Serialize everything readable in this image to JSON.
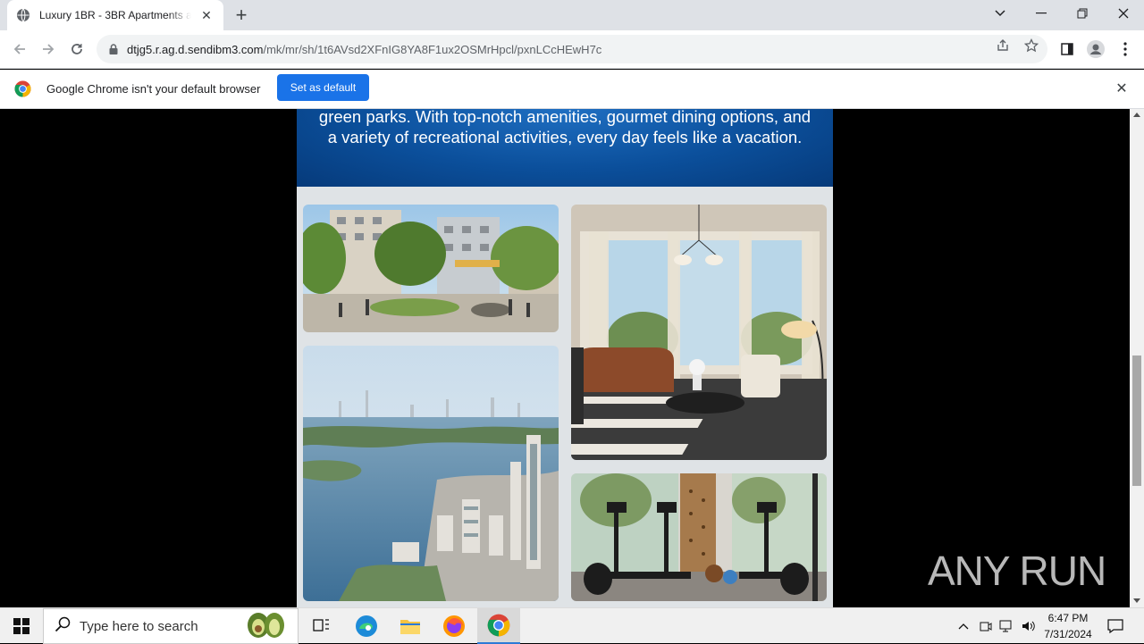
{
  "browser": {
    "tab": {
      "title": "Luxury 1BR - 3BR Apartments at"
    },
    "address": {
      "host": "dtjg5.r.ag.d.sendibm3.com",
      "path": "/mk/mr/sh/1t6AVsd2XFnIG8YA8F1ux2OSMrHpcl/pxnLCcHEwH7c"
    },
    "infobar": {
      "message": "Google Chrome isn't your default browser",
      "button_label": "Set as default"
    }
  },
  "email": {
    "banner_text": "green parks. With top-notch amenities, gourmet dining options, and a variety of recreational activities, every day feels like a vacation."
  },
  "watermark": {
    "text": "ANY RUN"
  },
  "taskbar": {
    "search_placeholder": "Type here to search",
    "time": "6:47 PM",
    "date": "7/31/2024"
  },
  "colors": {
    "accent": "#1a73e8",
    "banner": "#0b4f9b",
    "page_bg": "#dfe3e6"
  }
}
